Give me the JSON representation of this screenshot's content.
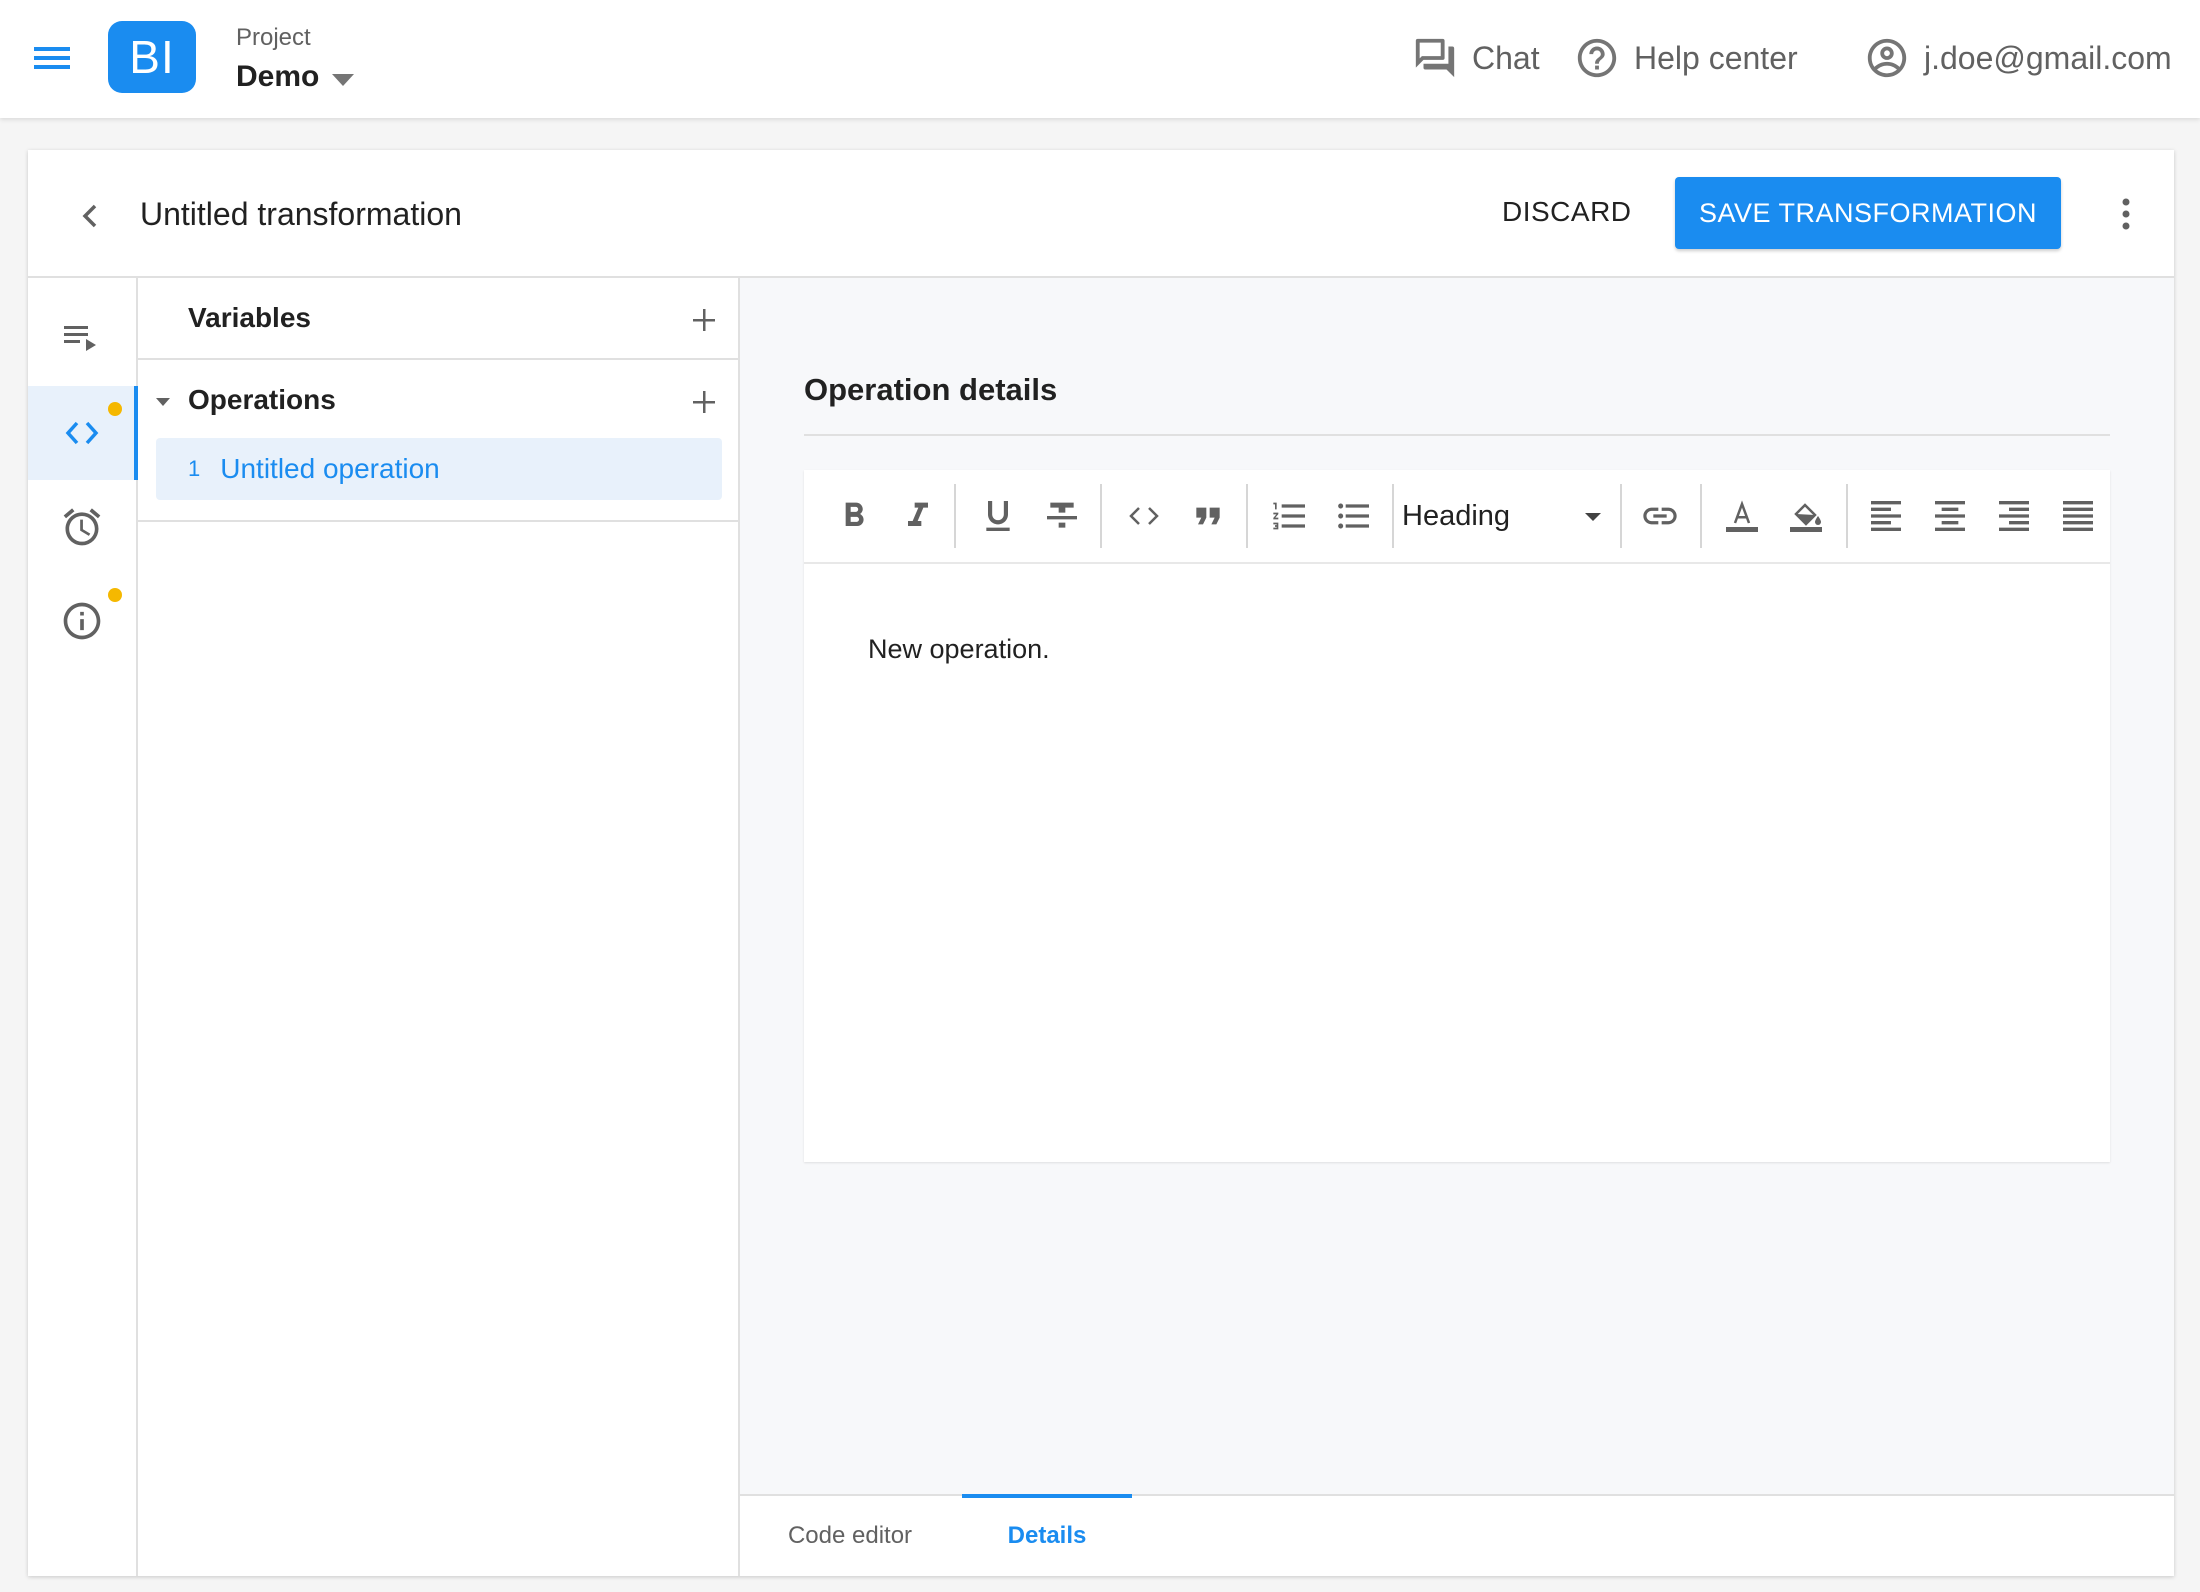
{
  "topbar": {
    "logo_text": "BI",
    "project_caption": "Project",
    "project_name": "Demo",
    "chat_label": "Chat",
    "help_label": "Help center",
    "user_email": "j.doe@gmail.com"
  },
  "header": {
    "title": "Untitled transformation",
    "discard_label": "DISCARD",
    "save_label": "SAVE TRANSFORMATION"
  },
  "rail": {
    "items": [
      {
        "icon": "playlist-play-icon",
        "active": false,
        "badge": false
      },
      {
        "icon": "code-icon",
        "active": true,
        "badge": true
      },
      {
        "icon": "alarm-icon",
        "active": false,
        "badge": false
      },
      {
        "icon": "info-icon",
        "active": false,
        "badge": true
      }
    ]
  },
  "tree": {
    "variables_label": "Variables",
    "operations_label": "Operations",
    "operations": [
      {
        "number": "1",
        "name": "Untitled operation",
        "selected": true
      }
    ]
  },
  "detail": {
    "title": "Operation details",
    "heading_select": "Heading",
    "body_text": "New operation."
  },
  "tabs": [
    {
      "label": "Code editor",
      "active": false
    },
    {
      "label": "Details",
      "active": true
    }
  ],
  "colors": {
    "accent": "#1a8cf0",
    "badge": "#f5b800",
    "selected_bg": "#e8f1fb"
  }
}
